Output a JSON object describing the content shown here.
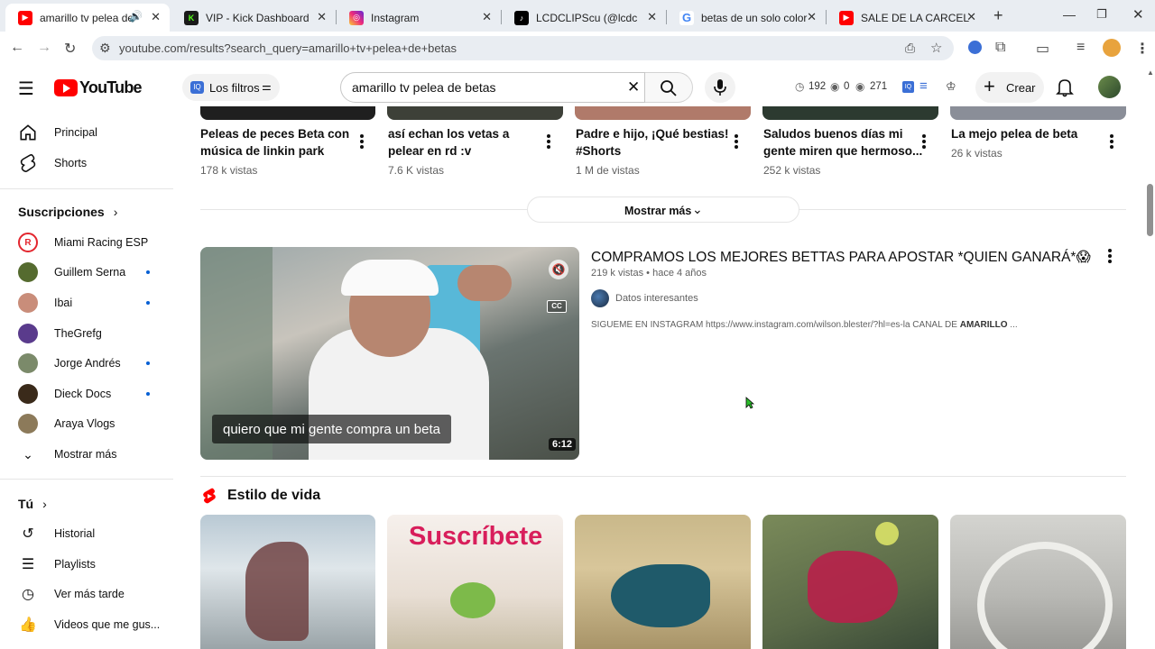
{
  "browser": {
    "tabs": [
      {
        "title": "amarillo tv pelea de be",
        "active": true,
        "favicon": "youtube-icon",
        "color": "#ff0000"
      },
      {
        "title": "VIP - Kick Dashboard",
        "favicon": "kick-icon",
        "color": "#53fc18"
      },
      {
        "title": "Instagram",
        "favicon": "instagram-icon",
        "color": "#d62976"
      },
      {
        "title": "LCDCLIPScu (@lcdclips) | Ti",
        "favicon": "tiktok-icon",
        "color": "#000000"
      },
      {
        "title": "betas de un solo color com",
        "favicon": "google-icon",
        "color": "#4285f4"
      },
      {
        "title": "SALE DE LA CARCEL Y GAN",
        "favicon": "youtube-icon",
        "color": "#ff0000"
      }
    ],
    "new_tab": "+",
    "url": "youtube.com/results?search_query=amarillo+tv+pelea+de+betas"
  },
  "youtube": {
    "logo_text": "YouTube",
    "filters_label": "Los filtros",
    "search_value": "amarillo tv pelea de betas",
    "stats": {
      "clock": "192",
      "eye1": "0",
      "eye2": "271"
    },
    "create_label": "Crear"
  },
  "sidebar": {
    "main": [
      {
        "label": "Principal",
        "icon": "home-icon"
      },
      {
        "label": "Shorts",
        "icon": "shorts-icon"
      }
    ],
    "subs_header": "Suscripciones",
    "subscriptions": [
      {
        "label": "Miami Racing ESP",
        "color": "#e3262e",
        "dot": false
      },
      {
        "label": "Guillem Serna",
        "color": "#556b2f",
        "dot": true
      },
      {
        "label": "Ibai",
        "color": "#c98d7a",
        "dot": true
      },
      {
        "label": "TheGrefg",
        "color": "#5a3b8c",
        "dot": false
      },
      {
        "label": "Jorge Andrés",
        "color": "#7b8a6a",
        "dot": true
      },
      {
        "label": "Dieck Docs",
        "color": "#3a2a1a",
        "dot": true
      },
      {
        "label": "Araya Vlogs",
        "color": "#8c7a5a",
        "dot": false
      }
    ],
    "show_more": "Mostrar más",
    "you_header": "Tú",
    "you_items": [
      {
        "label": "Historial",
        "icon": "history-icon"
      },
      {
        "label": "Playlists",
        "icon": "playlist-icon"
      },
      {
        "label": "Ver más tarde",
        "icon": "watch-later-icon"
      },
      {
        "label": "Videos que me gus...",
        "icon": "like-icon"
      }
    ]
  },
  "shorts_row": [
    {
      "title_line1": "Peleas de peces Beta con",
      "title_line2": "música de linkin park",
      "views": "178 k vistas"
    },
    {
      "title_line1": "así echan los vetas a",
      "title_line2": "pelear en rd :v",
      "views": "7.6 K vistas"
    },
    {
      "title_line1": "Padre e hijo, ¡Qué bestias!",
      "title_line2": "#Shorts",
      "views": "1 M de vistas"
    },
    {
      "title_line1": "Saludos buenos días mi",
      "title_line2": "gente miren que hermoso...",
      "views": "252 k vistas"
    },
    {
      "title_line1": "La mejo pelea de beta",
      "title_line2": "",
      "views": "26 k vistas"
    }
  ],
  "show_more_button": "Mostrar más",
  "video": {
    "title": "COMPRAMOS LOS MEJORES BETTAS PARA APOSTAR *QUIEN GANARÁ*😱",
    "views": "219 k vistas",
    "separator": "•",
    "age": "hace 4 años",
    "channel": "Datos interesantes",
    "description_prefix": "SIGUEME EN INSTAGRAM https://www.instagram.com/wilson.blester/?hl=es-la CANAL DE ",
    "description_bold": "AMARILLO",
    "description_suffix": " ...",
    "caption": "quiero que mi gente compra un beta",
    "duration": "6:12",
    "cc": "CC"
  },
  "section": {
    "title": "Estilo de vida",
    "thumb2_text": "Suscríbete"
  }
}
